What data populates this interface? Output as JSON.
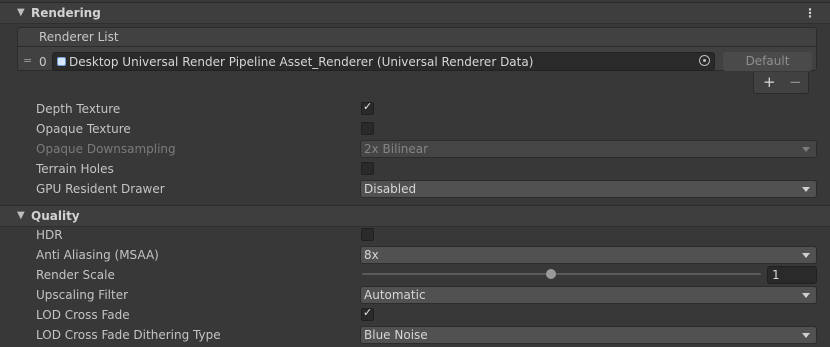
{
  "rendering": {
    "title": "Rendering",
    "renderer_list": {
      "header": "Renderer List",
      "items": [
        {
          "index": "0",
          "value": "Desktop Universal Render Pipeline Asset_Renderer (Universal Renderer Data)",
          "default_label": "Default"
        }
      ],
      "add_label": "+",
      "remove_label": "−"
    },
    "depth_texture": {
      "label": "Depth Texture",
      "checked": true,
      "mark": "✓"
    },
    "opaque_texture": {
      "label": "Opaque Texture",
      "checked": false
    },
    "opaque_downsampling": {
      "label": "Opaque Downsampling",
      "value": "2x Bilinear",
      "disabled": true
    },
    "terrain_holes": {
      "label": "Terrain Holes",
      "checked": false
    },
    "gpu_resident_drawer": {
      "label": "GPU Resident Drawer",
      "value": "Disabled"
    }
  },
  "quality": {
    "title": "Quality",
    "hdr": {
      "label": "HDR",
      "checked": false
    },
    "anti_aliasing": {
      "label": "Anti Aliasing (MSAA)",
      "value": "8x"
    },
    "render_scale": {
      "label": "Render Scale",
      "value": "1"
    },
    "upscaling_filter": {
      "label": "Upscaling Filter",
      "value": "Automatic"
    },
    "lod_cross_fade": {
      "label": "LOD Cross Fade",
      "checked": true,
      "mark": "✓"
    },
    "lod_dither_type": {
      "label": "LOD Cross Fade Dithering Type",
      "value": "Blue Noise"
    }
  },
  "icons": {
    "collapse": "▼",
    "kebab": "⋮",
    "drag_handle": "="
  }
}
